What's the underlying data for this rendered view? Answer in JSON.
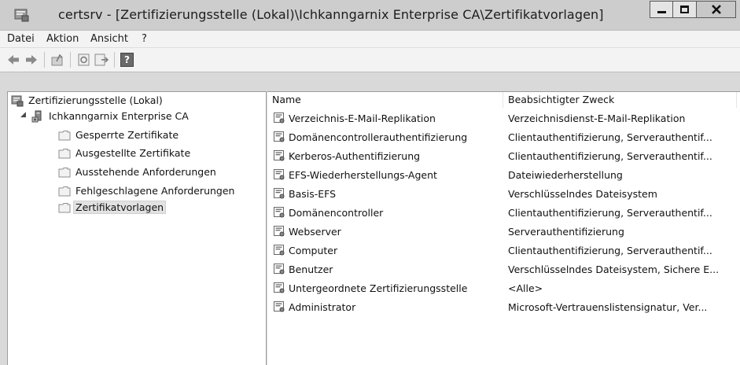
{
  "window": {
    "title": "certsrv - [Zertifizierungsstelle (Lokal)\\Ichkanngarnix Enterprise CA\\Zertifikatvorlagen]"
  },
  "menu": [
    "Datei",
    "Aktion",
    "Ansicht",
    "?"
  ],
  "toolbar": {
    "buttons": [
      "back-icon",
      "forward-icon",
      "up-icon",
      "refresh-icon",
      "export-list-icon",
      "help-icon"
    ],
    "help_glyph": "?"
  },
  "tree": {
    "root": "Zertifizierungsstelle (Lokal)",
    "ca": "Ichkanngarnix Enterprise CA",
    "expander": "◢",
    "children": [
      "Gesperrte Zertifikate",
      "Ausgestellte Zertifikate",
      "Ausstehende Anforderungen",
      "Fehlgeschlagene Anforderungen",
      "Zertifikatvorlagen"
    ],
    "selected": "Zertifikatvorlagen"
  },
  "list": {
    "columns": [
      "Name",
      "Beabsichtigter Zweck"
    ],
    "rows": [
      {
        "name": "Verzeichnis-E-Mail-Replikation",
        "purpose": "Verzeichnisdienst-E-Mail-Replikation"
      },
      {
        "name": "Domänencontrollerauthentifizierung",
        "purpose": "Clientauthentifizierung, Serverauthentif..."
      },
      {
        "name": "Kerberos-Authentifizierung",
        "purpose": "Clientauthentifizierung, Serverauthentif..."
      },
      {
        "name": "EFS-Wiederherstellungs-Agent",
        "purpose": "Dateiwiederherstellung"
      },
      {
        "name": "Basis-EFS",
        "purpose": "Verschlüsselndes Dateisystem"
      },
      {
        "name": "Domänencontroller",
        "purpose": "Clientauthentifizierung, Serverauthentif..."
      },
      {
        "name": "Webserver",
        "purpose": "Serverauthentifizierung"
      },
      {
        "name": "Computer",
        "purpose": "Clientauthentifizierung, Serverauthentif..."
      },
      {
        "name": "Benutzer",
        "purpose": "Verschlüsselndes Dateisystem, Sichere E..."
      },
      {
        "name": "Untergeordnete Zertifizierungsstelle",
        "purpose": "<Alle>"
      },
      {
        "name": "Administrator",
        "purpose": "Microsoft-Vertrauenslistensignatur, Ver..."
      }
    ]
  }
}
